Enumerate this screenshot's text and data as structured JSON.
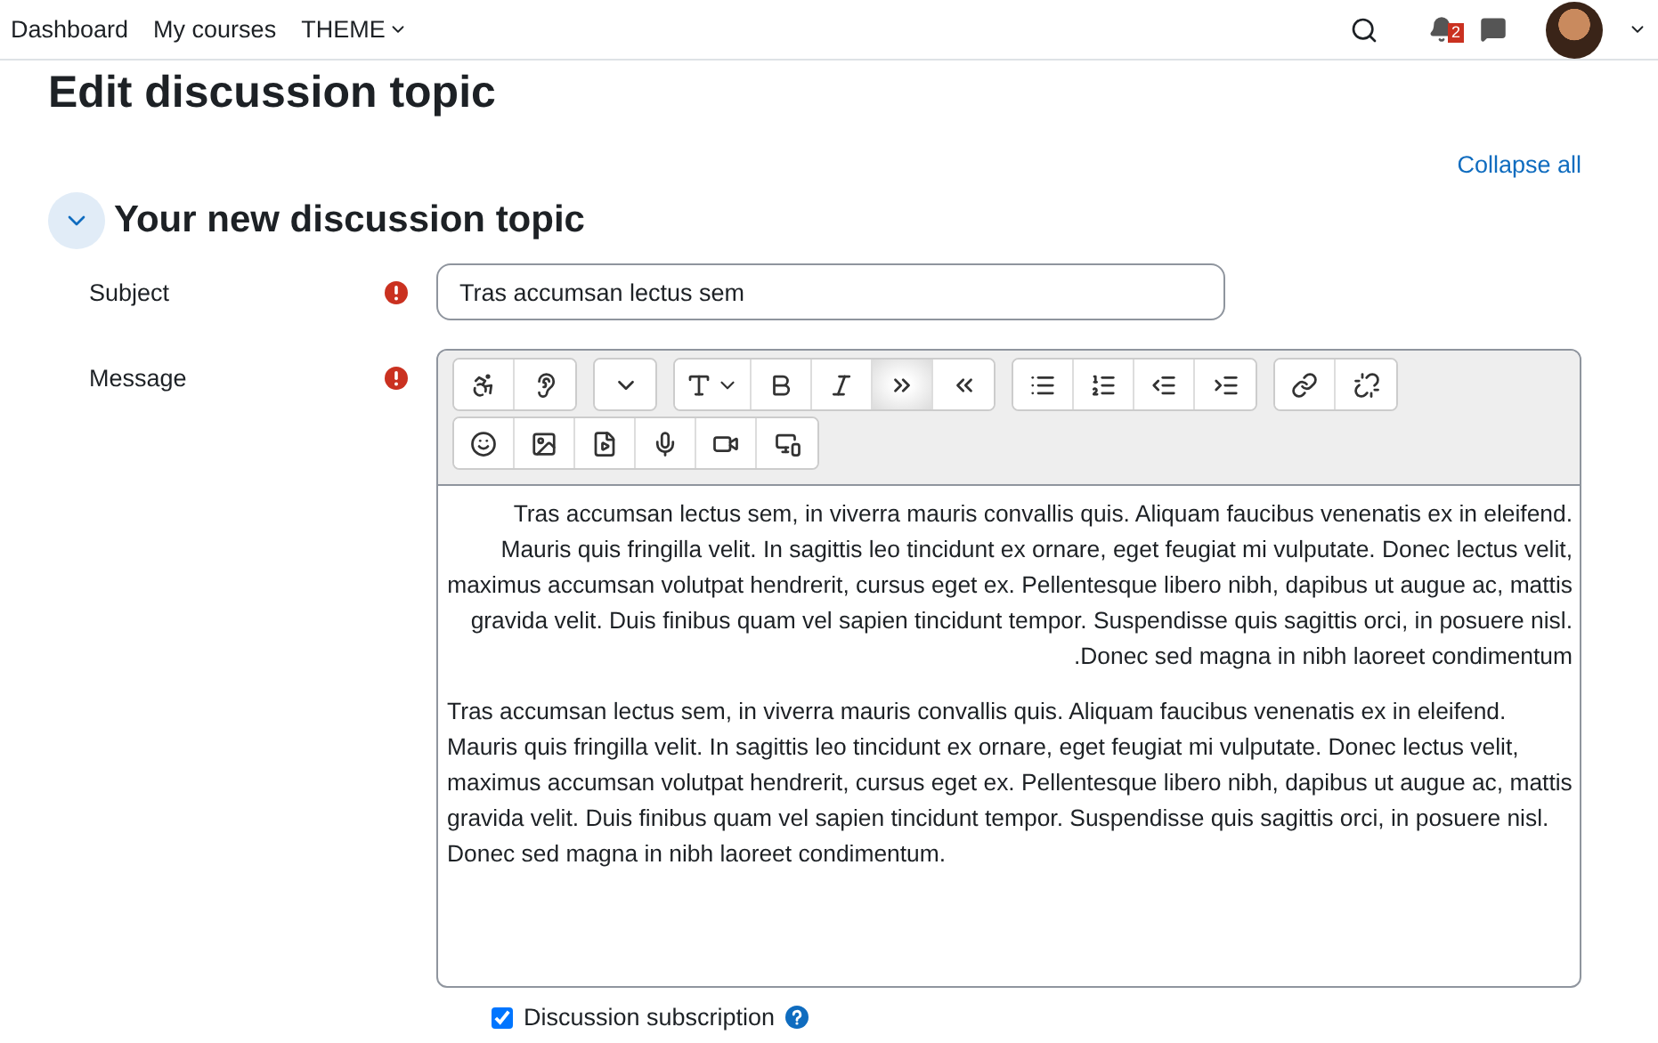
{
  "nav": {
    "links": [
      "Dashboard",
      "My courses"
    ],
    "menu": "THEME",
    "notification_count": "2"
  },
  "page_title": "Edit discussion topic",
  "collapse_all": "Collapse all",
  "section": {
    "title": "Your new discussion topic",
    "expanded": true
  },
  "subject": {
    "label": "Subject",
    "required": true,
    "value": "Tras accumsan lectus sem"
  },
  "message": {
    "label": "Message",
    "required": true,
    "toolbar": [
      [
        [
          {
            "pressed": false
          },
          {
            "pressed": false
          }
        ],
        [
          {
            "pressed": false
          }
        ],
        [
          {
            "pressed": false
          },
          {
            "pressed": false
          },
          {
            "pressed": false
          },
          {
            "pressed": true
          },
          {
            "pressed": false
          }
        ],
        [
          {
            "pressed": false
          },
          {
            "pressed": false
          },
          {
            "pressed": false
          },
          {
            "pressed": false
          }
        ],
        [
          {
            "pressed": false
          },
          {
            "pressed": false
          }
        ]
      ],
      [
        [
          {
            "pressed": false
          },
          {
            "pressed": false
          },
          {
            "pressed": false
          },
          {
            "pressed": false
          },
          {
            "pressed": false
          },
          {
            "pressed": false
          }
        ]
      ]
    ],
    "paragraphs": [
      {
        "kind": "rtl",
        "text": "Tras accumsan lectus sem, in viverra mauris convallis quis. Aliquam faucibus venenatis ex in eleifend. Mauris quis fringilla velit. In sagittis leo tincidunt ex ornare, eget feugiat mi vulputate. Donec lectus velit, maximus accumsan volutpat hendrerit, cursus eget ex. Pellentesque libero nibh, dapibus ut augue ac, mattis gravida velit. Duis finibus quam vel sapien tincidunt tempor. Suspendisse quis sagittis orci, in posuere nisl. Donec sed magna in nibh laoreet condimentum."
      },
      {
        "kind": "ltr",
        "text": "Tras accumsan lectus sem, in viverra mauris convallis quis. Aliquam faucibus venenatis ex in eleifend. Mauris quis fringilla velit. In sagittis leo tincidunt ex ornare, eget feugiat mi vulputate. Donec lectus velit, maximus accumsan volutpat hendrerit, cursus eget ex. Pellentesque libero nibh, dapibus ut augue ac, mattis gravida velit. Duis finibus quam vel sapien tincidunt tempor. Suspendisse quis sagittis orci, in posuere nisl. Donec sed magna in nibh laoreet condimentum."
      }
    ]
  },
  "subscription": {
    "label": "Discussion subscription",
    "checked": true
  }
}
